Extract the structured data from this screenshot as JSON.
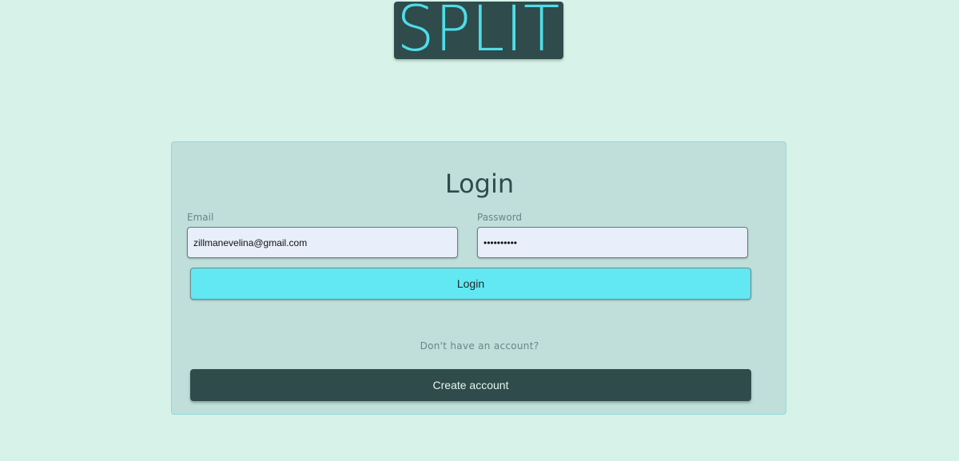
{
  "app": {
    "logo_text": "SPLIT"
  },
  "login_form": {
    "title": "Login",
    "email": {
      "label": "Email",
      "value": "zillmanevelina@gmail.com"
    },
    "password": {
      "label": "Password",
      "value": "••••••••••"
    },
    "login_button_label": "Login",
    "no_account_prompt": "Don't have an account?",
    "create_account_button_label": "Create account"
  },
  "colors": {
    "page_background": "#d7f2e9",
    "card_background": "#c0dfdb",
    "accent_cyan": "#62e8f2",
    "dark_teal": "#2f4b4b",
    "input_background": "#e8effb"
  }
}
